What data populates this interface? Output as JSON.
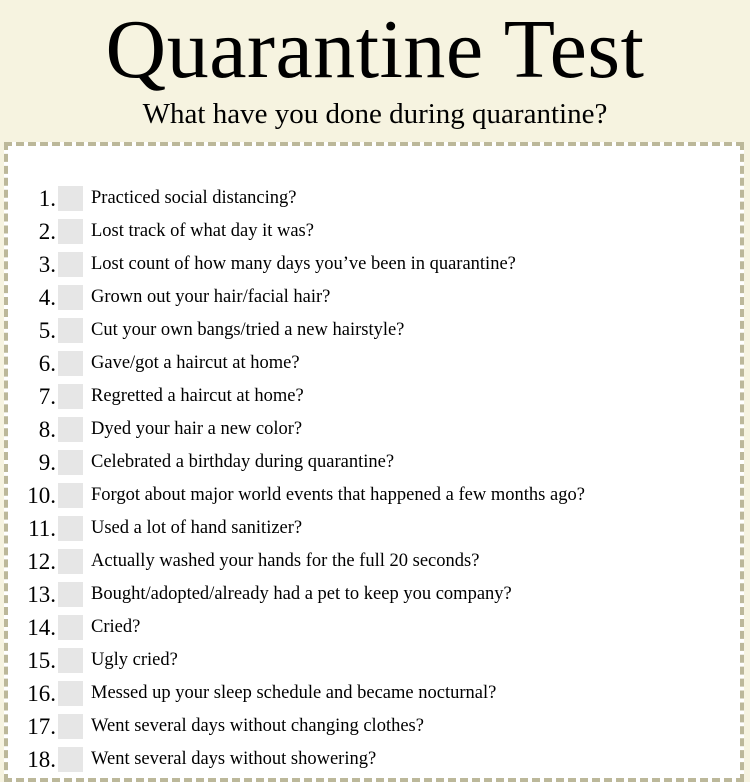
{
  "header": {
    "title": "Quarantine Test",
    "subtitle": "What have you done during quarantine?"
  },
  "colors": {
    "page_background": "#f6f3e0",
    "card_background": "#ffffff",
    "dashed_border": "#bcb89a",
    "checkbox": "#e6e6e6"
  },
  "questions": [
    {
      "number": "1.",
      "text": "Practiced social distancing?"
    },
    {
      "number": "2.",
      "text": "Lost track of what day it was?"
    },
    {
      "number": "3.",
      "text": "Lost count of how many days you’ve been in quarantine?"
    },
    {
      "number": "4.",
      "text": "Grown out your hair/facial hair?"
    },
    {
      "number": "5.",
      "text": "Cut your own bangs/tried a new hairstyle?"
    },
    {
      "number": "6.",
      "text": "Gave/got a haircut at home?"
    },
    {
      "number": "7.",
      "text": "Regretted a haircut at home?"
    },
    {
      "number": "8.",
      "text": "Dyed your hair a new color?"
    },
    {
      "number": "9.",
      "text": "Celebrated a birthday during quarantine?"
    },
    {
      "number": "10.",
      "text": "Forgot about major world events that happened a few months ago?"
    },
    {
      "number": "11.",
      "text": "Used a lot of hand sanitizer?"
    },
    {
      "number": "12.",
      "text": "Actually washed your hands for the full 20 seconds?"
    },
    {
      "number": "13.",
      "text": "Bought/adopted/already had a pet to keep you company?"
    },
    {
      "number": "14.",
      "text": "Cried?"
    },
    {
      "number": "15.",
      "text": "Ugly cried?"
    },
    {
      "number": "16.",
      "text": "Messed up your sleep schedule and became nocturnal?"
    },
    {
      "number": "17.",
      "text": "Went several days without changing clothes?"
    },
    {
      "number": "18.",
      "text": "Went several days without showering?"
    }
  ]
}
